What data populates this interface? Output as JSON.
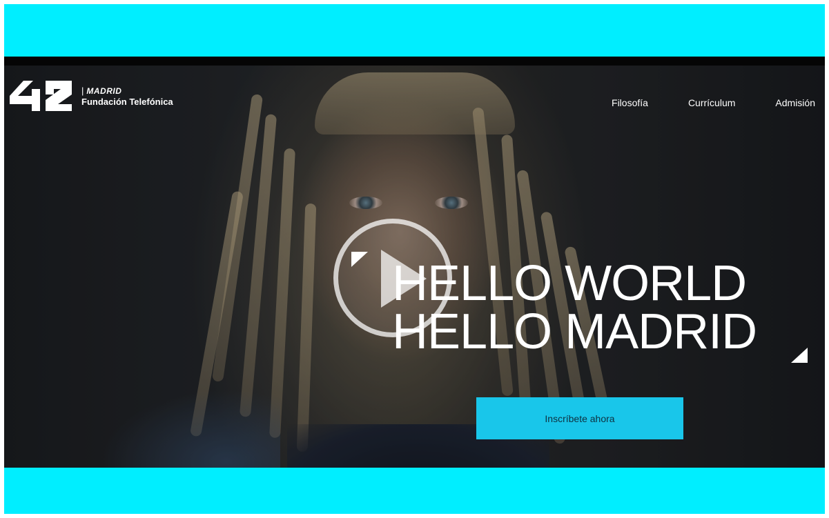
{
  "header": {
    "logo": {
      "mark": "42",
      "city": "MADRID",
      "sponsor": "Fundación Telefónica"
    },
    "nav": [
      {
        "label": "Filosofía"
      },
      {
        "label": "Currículum"
      },
      {
        "label": "Admisión"
      }
    ]
  },
  "hero": {
    "headline_line1": "HELLO WORLD",
    "headline_line2": "HELLO MADRID",
    "cta_label": "Inscríbete ahora"
  },
  "colors": {
    "frame": "#00eeff",
    "cta": "#19c6ea",
    "text": "#ffffff"
  },
  "icons": {
    "play": "play-icon",
    "corner_top_left": "corner-triangle-icon",
    "corner_bottom_right": "corner-triangle-icon"
  }
}
